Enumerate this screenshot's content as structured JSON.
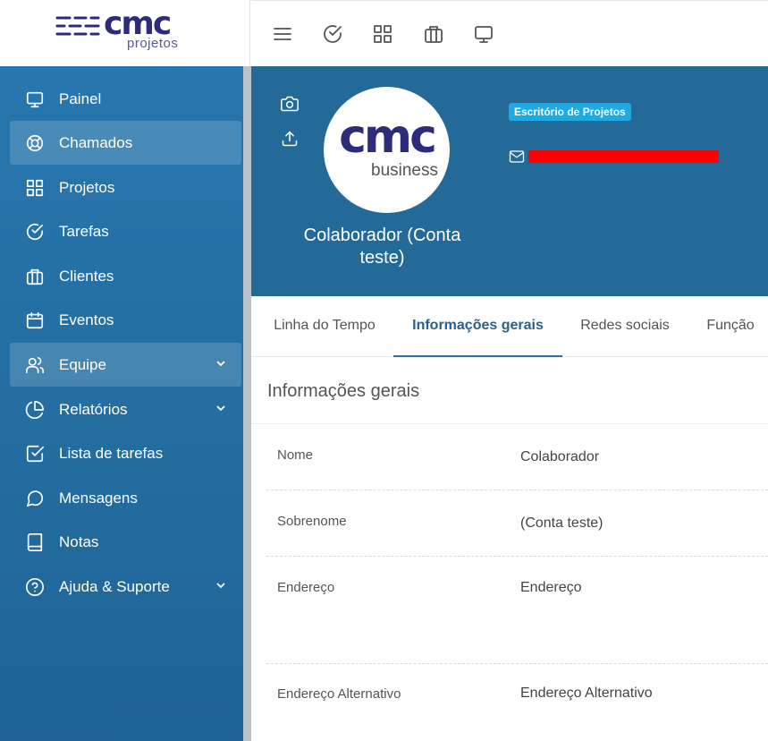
{
  "brand": {
    "logo_text": "cmc",
    "logo_sub": "projetos"
  },
  "topbar": {
    "icons": [
      "menu-icon",
      "check-circle-icon",
      "grid-icon",
      "briefcase-icon",
      "monitor-icon"
    ]
  },
  "sidebar": {
    "items": [
      {
        "label": "Painel",
        "icon": "monitor-icon",
        "active": false,
        "has_submenu": false
      },
      {
        "label": "Chamados",
        "icon": "lifebuoy-icon",
        "active": true,
        "has_submenu": false
      },
      {
        "label": "Projetos",
        "icon": "grid-icon",
        "active": false,
        "has_submenu": false
      },
      {
        "label": "Tarefas",
        "icon": "check-circle-icon",
        "active": false,
        "has_submenu": false
      },
      {
        "label": "Clientes",
        "icon": "briefcase-icon",
        "active": false,
        "has_submenu": false
      },
      {
        "label": "Eventos",
        "icon": "calendar-icon",
        "active": false,
        "has_submenu": false
      },
      {
        "label": "Equipe",
        "icon": "users-icon",
        "active": true,
        "has_submenu": true
      },
      {
        "label": "Relatórios",
        "icon": "pie-chart-icon",
        "active": false,
        "has_submenu": true
      },
      {
        "label": "Lista de tarefas",
        "icon": "check-square-icon",
        "active": false,
        "has_submenu": false
      },
      {
        "label": "Mensagens",
        "icon": "message-circle-icon",
        "active": false,
        "has_submenu": false
      },
      {
        "label": "Notas",
        "icon": "book-icon",
        "active": false,
        "has_submenu": false
      },
      {
        "label": "Ajuda & Suporte",
        "icon": "help-circle-icon",
        "active": false,
        "has_submenu": true
      }
    ]
  },
  "profile": {
    "avatar_logo": "cmc",
    "avatar_sub": "business",
    "name": "Colaborador (Conta teste)",
    "badge": "Escritório de Projetos",
    "icons": [
      "camera-icon",
      "upload-icon",
      "mail-icon"
    ]
  },
  "tabs": [
    {
      "label": "Linha do Tempo",
      "active": false
    },
    {
      "label": "Informações gerais",
      "active": true
    },
    {
      "label": "Redes sociais",
      "active": false
    },
    {
      "label": "Função",
      "active": false
    }
  ],
  "info": {
    "title": "Informações gerais",
    "rows": [
      {
        "label": "Nome",
        "value": "Colaborador"
      },
      {
        "label": "Sobrenome",
        "value": "(Conta teste)"
      },
      {
        "label": "Endereço",
        "value": "Endereço"
      },
      {
        "label": "Endereço Alternativo",
        "value": "Endereço Alternativo"
      }
    ]
  },
  "colors": {
    "sidebar": "#2777ae",
    "profile_header": "#236a99",
    "badge": "#1dabe3",
    "brand": "#2d2c7c",
    "active_tab": "#2b5f8d"
  }
}
